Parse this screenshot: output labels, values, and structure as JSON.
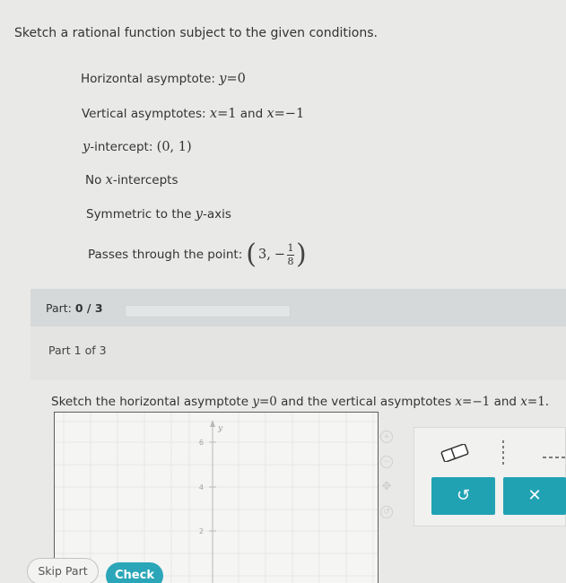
{
  "instruction": "Sketch a rational function subject to the given conditions.",
  "conditions": {
    "horizontal": {
      "label": "Horizontal asymptote:",
      "var": "y",
      "eq": "=",
      "val": "0"
    },
    "vertical": {
      "label": "Vertical asymptotes:",
      "var1": "x",
      "eq1": "=",
      "val1": "1",
      "and": "and",
      "var2": "x",
      "eq2": "=",
      "val2": "−1"
    },
    "intercept": {
      "var": "y",
      "label": "-intercept:",
      "val": "(0, 1)"
    },
    "no_x": {
      "prefix": "No",
      "var": "x",
      "label": "-intercepts"
    },
    "symmetric": {
      "label": "Symmetric to the",
      "var": "y",
      "suffix": "-axis"
    },
    "point": {
      "label": "Passes through the point:",
      "x": "3,",
      "sign": "−",
      "num": "1",
      "den": "8"
    }
  },
  "part": {
    "label": "Part:",
    "value": "0 / 3",
    "progress": 0
  },
  "part_of": "Part 1 of 3",
  "sketch": {
    "pre": "Sketch the horizontal asymptote",
    "var1": "y",
    "eq1": "=",
    "val1": "0",
    "mid": "and the vertical asymptotes",
    "var2": "x",
    "eq2": "=",
    "val2": "−1",
    "and": "and",
    "var3": "x",
    "eq3": "=",
    "val3": "1."
  },
  "graph": {
    "y_axis_label": "y",
    "ticks": [
      "6",
      "4",
      "2"
    ]
  },
  "tools": {
    "undo": "↺",
    "clear": "✕"
  },
  "buttons": {
    "skip": "Skip Part",
    "check": "Check"
  }
}
